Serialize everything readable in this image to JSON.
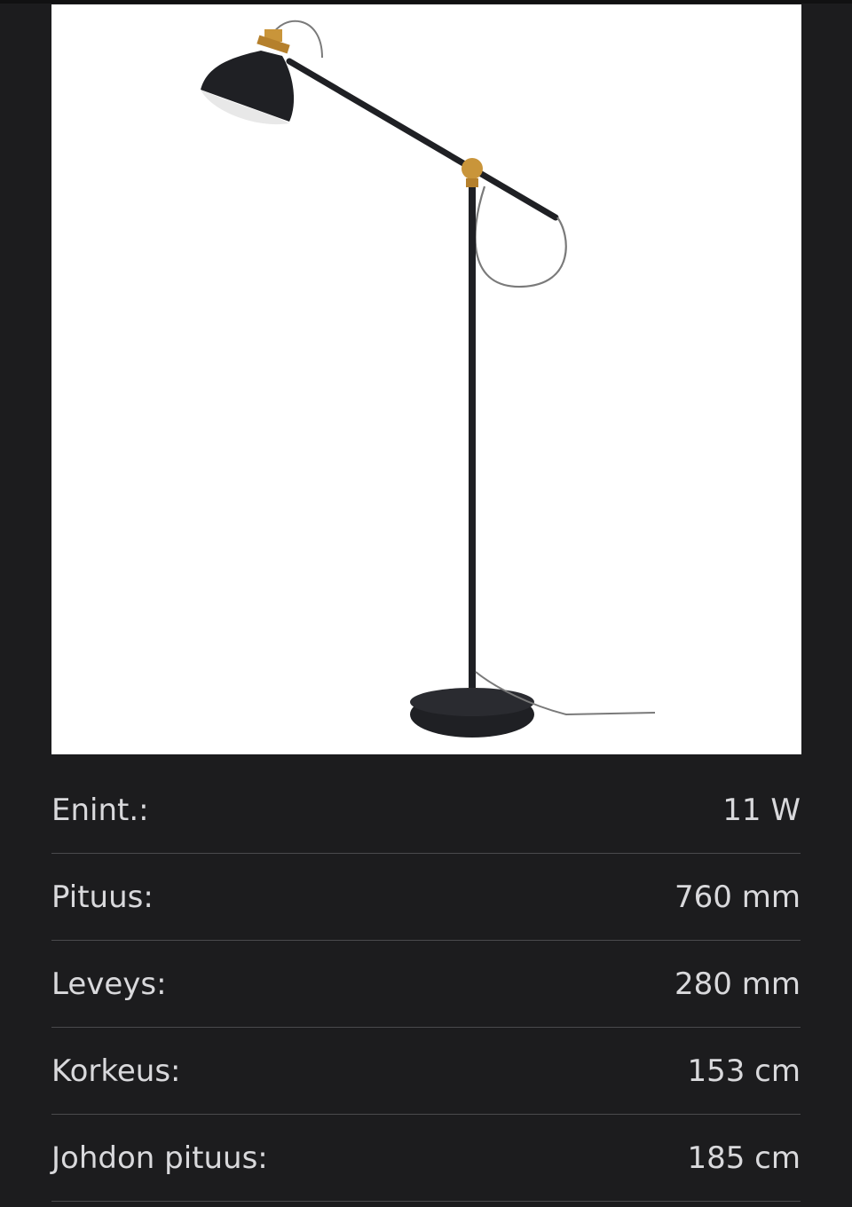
{
  "product": {
    "image_icon": "floor-lamp-photo"
  },
  "specs": [
    {
      "label": "Enint.:",
      "value": "11 W"
    },
    {
      "label": "Pituus:",
      "value": "760 mm"
    },
    {
      "label": "Leveys:",
      "value": "280 mm"
    },
    {
      "label": "Korkeus:",
      "value": "153 cm"
    },
    {
      "label": "Johdon pituus:",
      "value": "185 cm"
    }
  ],
  "colors": {
    "background": "#1c1c1e",
    "text": "#d9d9dc",
    "divider": "#4a4a4d",
    "lamp_black": "#1f2024",
    "brass": "#c9953a"
  }
}
